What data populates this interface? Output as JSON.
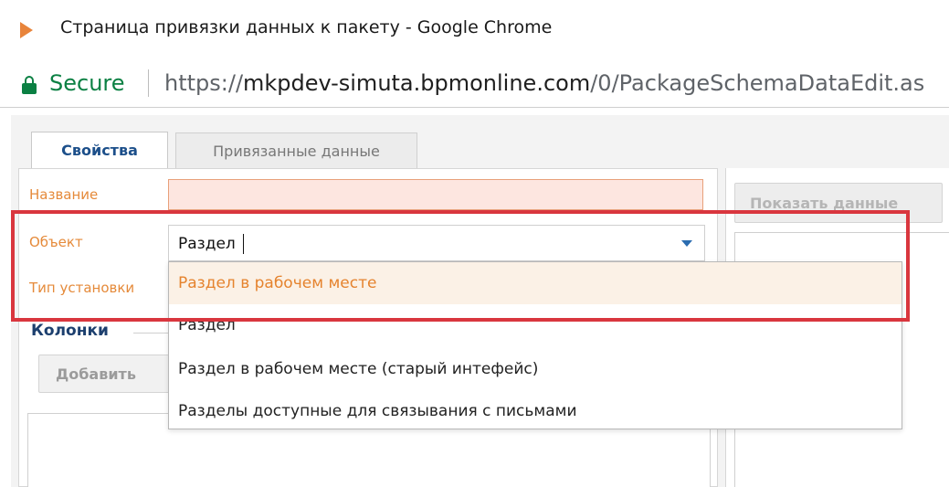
{
  "window": {
    "title": "Страница привязки данных к пакету - Google Chrome"
  },
  "addressbar": {
    "secure_label": "Secure",
    "url_prefix": "https://",
    "url_host": "mkpdev-simuta.bpmonline.com",
    "url_path": "/0/PackageSchemaDataEdit.as"
  },
  "tabs": [
    {
      "label": "Свойства",
      "active": true
    },
    {
      "label": "Привязанные данные",
      "active": false
    }
  ],
  "form": {
    "name_label": "Название",
    "name_value": "",
    "object_label": "Объект",
    "object_value": "Раздел",
    "install_type_label": "Тип установки"
  },
  "columns": {
    "title": "Колонки",
    "add_button_label": "Добавить"
  },
  "right_panel": {
    "show_data_button_label": "Показать данные"
  },
  "dropdown": {
    "items": [
      {
        "label": "Раздел в рабочем месте",
        "highlighted": true
      },
      {
        "label": "Раздел",
        "highlighted": false
      },
      {
        "label": "Раздел в рабочем месте (старый интефейс)",
        "highlighted": false
      },
      {
        "label": "Разделы доступные для связывания с письмами",
        "highlighted": false
      }
    ]
  },
  "colors": {
    "accent_orange": "#e58a3a",
    "secure_green": "#0b8043",
    "highlight_red": "#d9363e",
    "tab_active_text": "#1c4f8a"
  }
}
